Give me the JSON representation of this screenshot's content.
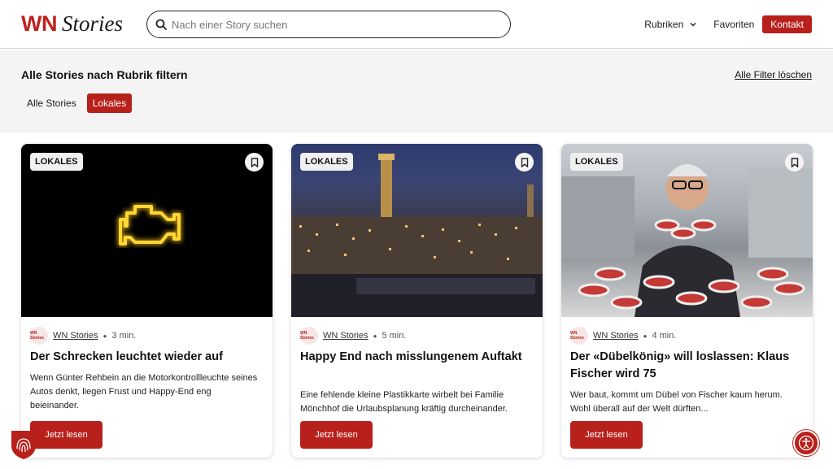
{
  "header": {
    "logo_wn": "WN",
    "logo_stories": "Stories",
    "search_placeholder": "Nach einer Story suchen",
    "nav": {
      "rubriken": "Rubriken",
      "favoriten": "Favoriten",
      "kontakt": "Kontakt"
    }
  },
  "filter": {
    "title": "Alle Stories nach Rubrik filtern",
    "clear": "Alle Filter löschen",
    "chips": [
      "Alle Stories",
      "Lokales"
    ]
  },
  "cards": [
    {
      "badge": "LOKALES",
      "avatar": "WN Stories",
      "source": "WN Stories",
      "read_time": "3 min.",
      "title": "Der Schrecken leuchtet wieder auf",
      "text": "Wenn Günter Rehbein an die Motorkontrollleuchte seines Autos denkt, liegen Frust und Happy-End eng beieinander.",
      "button": "Jetzt lesen"
    },
    {
      "badge": "LOKALES",
      "avatar": "WN Stories",
      "source": "WN Stories",
      "read_time": "5 min.",
      "title": "Happy End nach misslungenem Auftakt",
      "text": "Eine fehlende kleine Plastikkarte wirbelt bei Familie Mönchhof die Urlaubsplanung kräftig durcheinander.",
      "button": "Jetzt lesen"
    },
    {
      "badge": "LOKALES",
      "avatar": "WN Stories",
      "source": "WN Stories",
      "read_time": "4 min.",
      "title": "Der «Dübelkönig» will loslassen: Klaus Fischer wird 75",
      "text": "Wer baut, kommt um Dübel von Fischer kaum herum. Wohl überall auf der Welt dürften...",
      "button": "Jetzt lesen"
    }
  ],
  "colors": {
    "brand": "#b8201c",
    "filter_bg": "#f4f4f4"
  },
  "icons": [
    "search-icon",
    "chevron-down-icon",
    "bookmark-icon",
    "fingerprint-icon",
    "accessibility-icon"
  ]
}
